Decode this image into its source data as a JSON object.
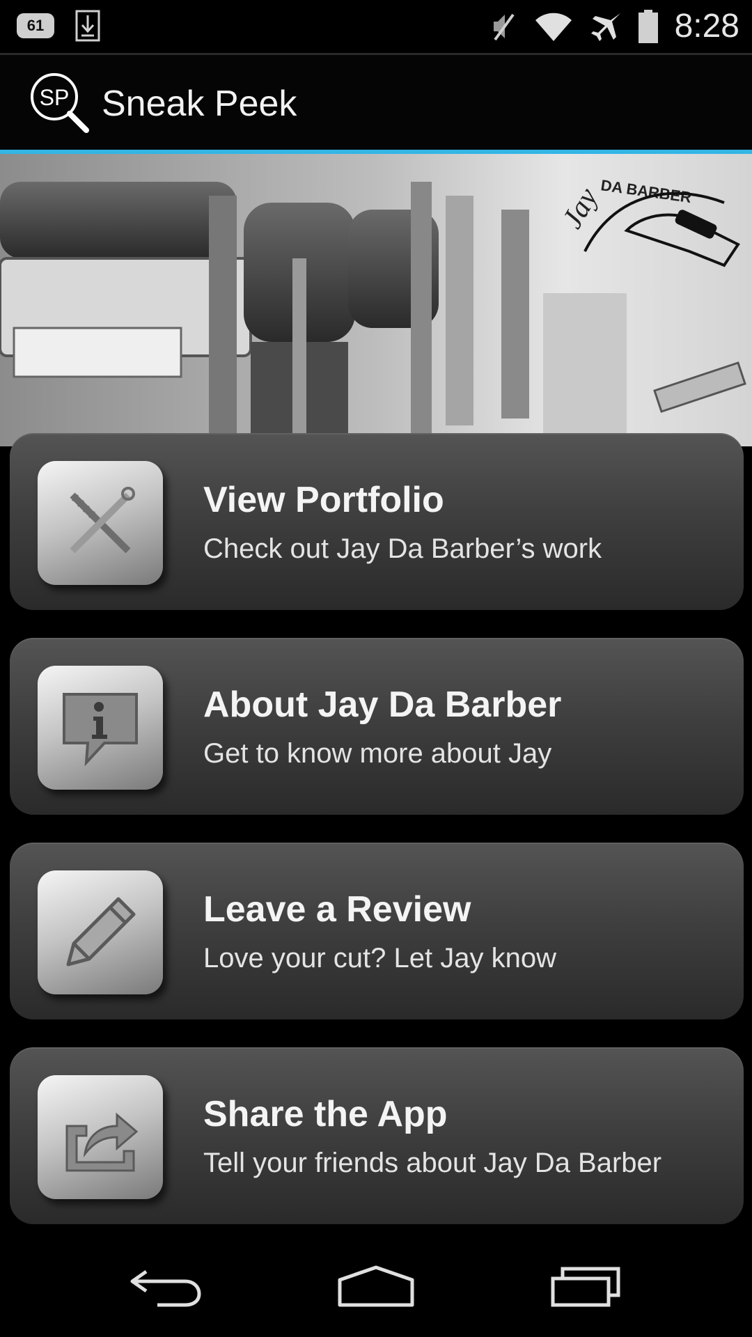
{
  "status_bar": {
    "notification_count": "61",
    "time": "8:28",
    "icons": [
      "download-icon",
      "mute-icon",
      "wifi-icon",
      "airplane-mode-icon",
      "battery-icon"
    ]
  },
  "action_bar": {
    "title": "Sneak Peek",
    "logo_text": "SP"
  },
  "banner": {
    "logo_script": "Jay",
    "logo_caption": "DA BARBER"
  },
  "menu": [
    {
      "title": "View Portfolio",
      "subtitle": "Check out Jay Da Barber’s work",
      "icon": "comb-scissors-icon"
    },
    {
      "title": "About Jay Da Barber",
      "subtitle": "Get to know more about Jay",
      "icon": "info-bubble-icon"
    },
    {
      "title": "Leave a Review",
      "subtitle": "Love your cut? Let Jay know",
      "icon": "pencil-icon"
    },
    {
      "title": "Share the App",
      "subtitle": "Tell your friends about Jay Da Barber",
      "icon": "share-icon"
    }
  ],
  "nav_bar": {
    "icons": [
      "back-icon",
      "home-icon",
      "recent-apps-icon"
    ]
  },
  "colors": {
    "accent": "#33b5e5",
    "background": "#000000"
  }
}
